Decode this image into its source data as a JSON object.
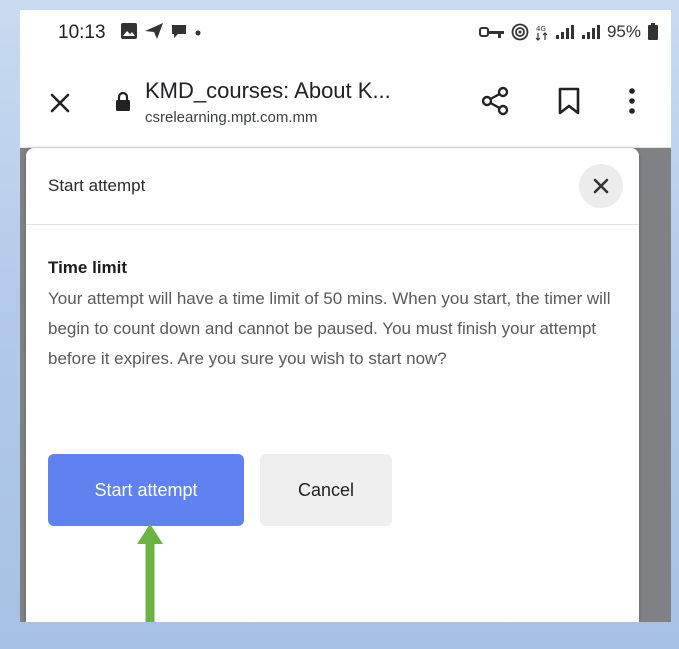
{
  "status_bar": {
    "time": "10:13",
    "left_icons": [
      "gallery-icon",
      "send-icon",
      "chat-bubble-icon",
      "dot-icon"
    ],
    "right_icons": [
      "key-icon",
      "hotspot-icon",
      "data-icon",
      "signal-icon",
      "signal-icon"
    ],
    "battery_percent": "95%"
  },
  "browser": {
    "title": "KMD_courses: About K...",
    "url": "csrelearning.mpt.com.mm"
  },
  "modal": {
    "title": "Start attempt",
    "section_heading": "Time limit",
    "message": "Your attempt will have a time limit of 50 mins. When you start, the timer will begin to count down and cannot be paused. You must finish your attempt before it expires. Are you sure you wish to start now?",
    "primary_button": "Start attempt",
    "secondary_button": "Cancel"
  },
  "colors": {
    "primary": "#5f82f0",
    "annotation_arrow": "#6db33f"
  }
}
